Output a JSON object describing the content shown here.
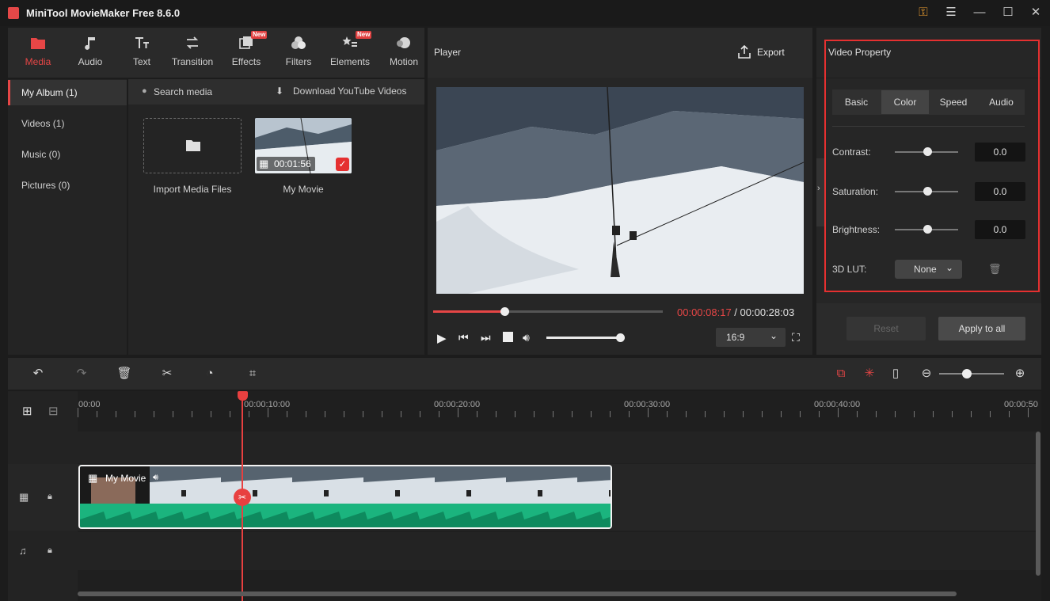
{
  "app": {
    "title": "MiniTool MovieMaker Free 8.6.0"
  },
  "top_tabs": [
    {
      "label": "Media",
      "icon": "folder-icon",
      "active": true
    },
    {
      "label": "Audio",
      "icon": "music-note-icon"
    },
    {
      "label": "Text",
      "icon": "text-icon"
    },
    {
      "label": "Transition",
      "icon": "transition-arrows-icon"
    },
    {
      "label": "Effects",
      "icon": "effects-icon",
      "badge": "New"
    },
    {
      "label": "Filters",
      "icon": "filters-icon"
    },
    {
      "label": "Elements",
      "icon": "elements-icon",
      "badge": "New"
    },
    {
      "label": "Motion",
      "icon": "motion-icon"
    }
  ],
  "album": [
    {
      "label": "My Album (1)",
      "active": true
    },
    {
      "label": "Videos (1)"
    },
    {
      "label": "Music (0)"
    },
    {
      "label": "Pictures (0)"
    }
  ],
  "media": {
    "search_placeholder": "Search media",
    "download_label": "Download YouTube Videos",
    "import_label": "Import Media Files",
    "clip_label": "My Movie",
    "clip_duration": "00:01:56"
  },
  "player": {
    "title": "Player",
    "export_label": "Export",
    "current_time": "00:00:08:17",
    "separator": " / ",
    "total_time": "00:00:28:03",
    "progress": 0.31,
    "volume": 1.0,
    "aspect": "16:9"
  },
  "property": {
    "title": "Video Property",
    "tabs": [
      "Basic",
      "Color",
      "Speed",
      "Audio"
    ],
    "active_tab": "Color",
    "contrast_label": "Contrast:",
    "contrast_value": "0.0",
    "saturation_label": "Saturation:",
    "saturation_value": "0.0",
    "brightness_label": "Brightness:",
    "brightness_value": "0.0",
    "lut_label": "3D LUT:",
    "lut_value": "None",
    "reset_label": "Reset",
    "apply_label": "Apply to all"
  },
  "timeline": {
    "ticks": [
      "00:00",
      "00:00:10:00",
      "00:00:20:00",
      "00:00:30:00",
      "00:00:40:00",
      "00:00:50"
    ],
    "clip_name": "My Movie"
  },
  "colors": {
    "accent": "#e64646",
    "audio_wave": "#1bb47e"
  }
}
